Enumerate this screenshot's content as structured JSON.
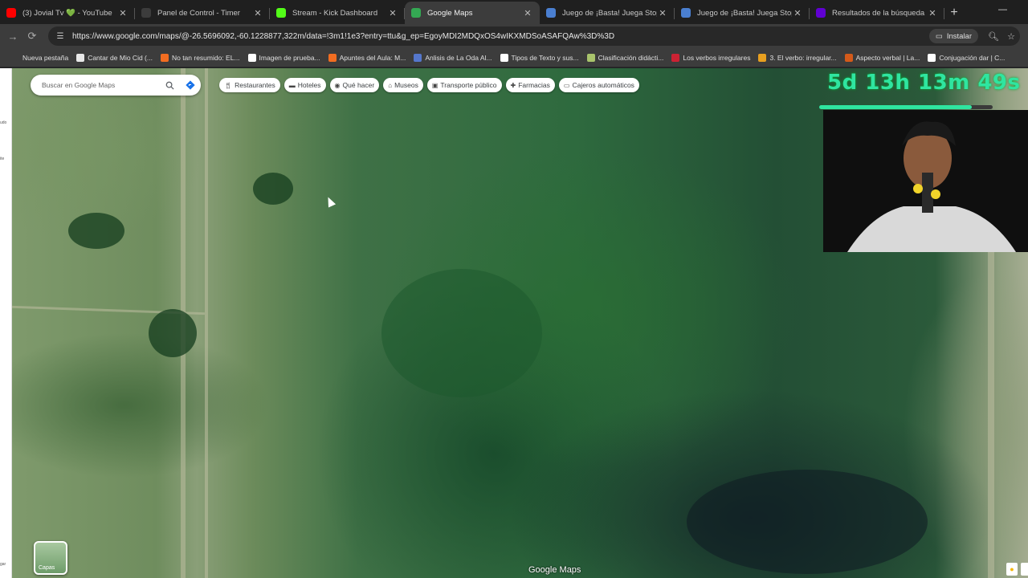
{
  "tabs": [
    {
      "label": "(3) Jovial Tv 💚 - YouTube",
      "icon": "youtube-icon",
      "color": "#ff0000",
      "active": false
    },
    {
      "label": "Panel de Control - Timer",
      "icon": "timer-icon",
      "color": "#3c3c3c",
      "active": false
    },
    {
      "label": "Stream - Kick Dashboard",
      "icon": "kick-icon",
      "color": "#53fc18",
      "active": false
    },
    {
      "label": "Google Maps",
      "icon": "maps-pin-icon",
      "color": "#34a853",
      "active": true
    },
    {
      "label": "Juego de ¡Basta! Juega Stop, Tu",
      "icon": "globe-icon",
      "color": "#4a7fd1",
      "active": false
    },
    {
      "label": "Juego de ¡Basta! Juega Stop, Tu",
      "icon": "globe-icon",
      "color": "#4a7fd1",
      "active": false
    },
    {
      "label": "Resultados de la búsqueda de",
      "icon": "yahoo-icon",
      "color": "#6001d2",
      "active": false
    }
  ],
  "toolbar": {
    "url": "https://www.google.com/maps/@-26.5696092,-60.1228877,322m/data=!3m1!1e3?entry=ttu&g_ep=EgoyMDI2MDQxOS4wIKXMDSoASAFQAw%3D%3D",
    "install_label": "Instalar"
  },
  "bookmarks": [
    {
      "label": "Nueva pestaña",
      "color": "transparent"
    },
    {
      "label": "Cantar de Mio Cid (...",
      "color": "#e8e8e8"
    },
    {
      "label": "No tan resumido: EL...",
      "color": "#f26d21"
    },
    {
      "label": "Imagen de prueba...",
      "color": "#ffffff"
    },
    {
      "label": "Apuntes del Aula: M...",
      "color": "#f26d21"
    },
    {
      "label": "Anlisis de La Oda Al...",
      "color": "#5577cc"
    },
    {
      "label": "Tipos de Texto y sus...",
      "color": "#ffffff"
    },
    {
      "label": "Clasificación didácti...",
      "color": "#a9c46c"
    },
    {
      "label": "Los verbos irregulares",
      "color": "#cc2233"
    },
    {
      "label": "3. El verbo: irregular...",
      "color": "#e8a020"
    },
    {
      "label": "Aspecto verbal | La...",
      "color": "#d45a1a"
    },
    {
      "label": "Conjugación dar | C...",
      "color": "#ffffff"
    }
  ],
  "map": {
    "search_placeholder": "Buscar en Google Maps",
    "chips": [
      {
        "label": "Restaurantes",
        "icon": "fork-knife-icon"
      },
      {
        "label": "Hoteles",
        "icon": "bed-icon"
      },
      {
        "label": "Qué hacer",
        "icon": "camera-icon"
      },
      {
        "label": "Museos",
        "icon": "museum-icon"
      },
      {
        "label": "Transporte público",
        "icon": "bus-icon"
      },
      {
        "label": "Farmacias",
        "icon": "pharmacy-icon"
      },
      {
        "label": "Cajeros automáticos",
        "icon": "atm-icon"
      }
    ],
    "layers_label": "Capas",
    "logo": "Google Maps"
  },
  "overlay": {
    "timer": "5d 13h 13m 49s",
    "timer_progress": 0.88
  },
  "left_rail": [
    "udo",
    "ite",
    "gar"
  ]
}
